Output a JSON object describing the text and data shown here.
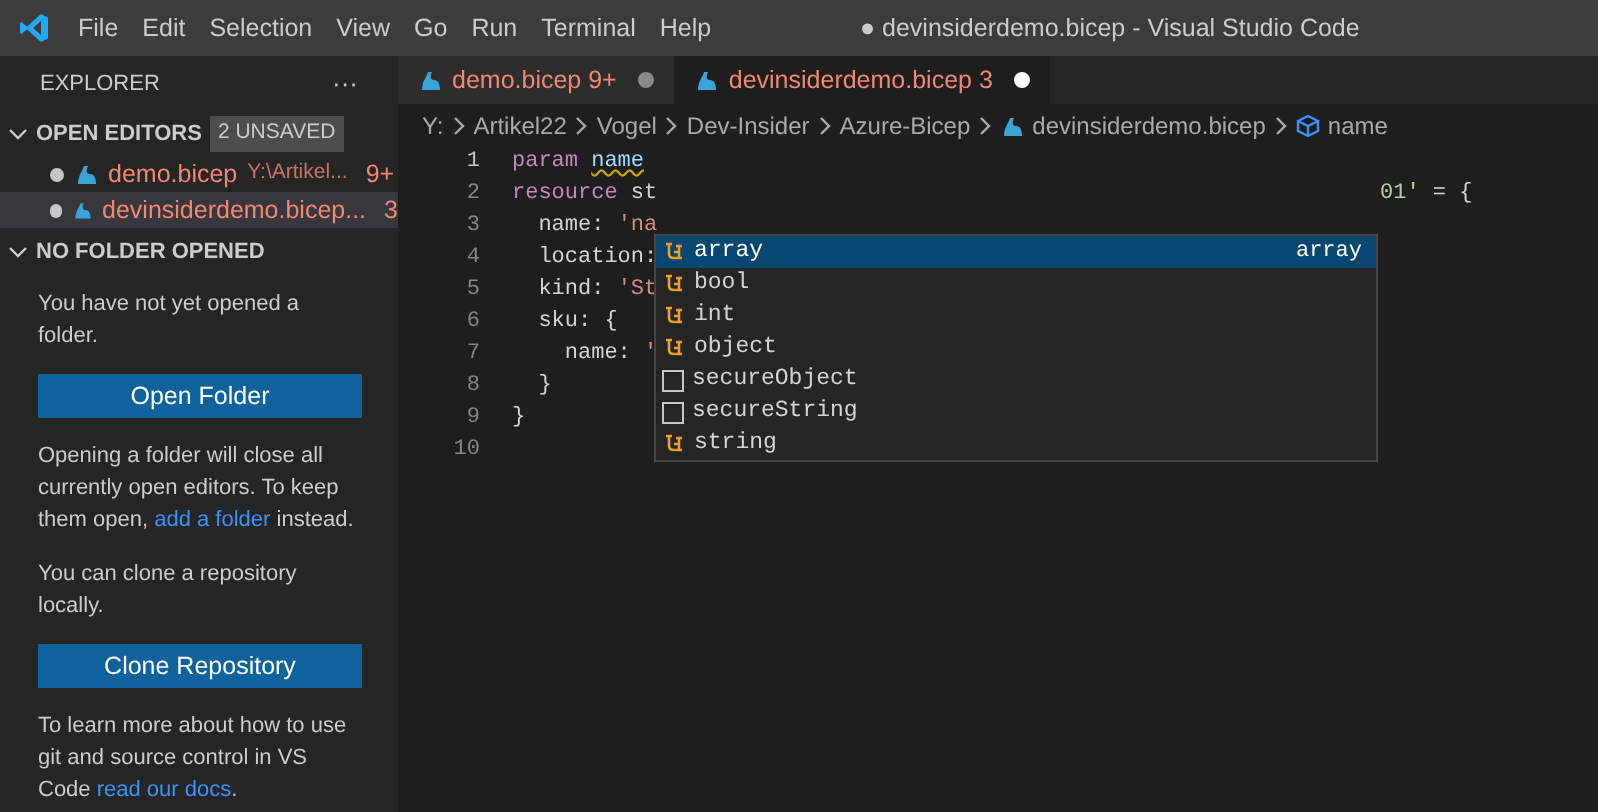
{
  "window": {
    "title": "● devinsiderdemo.bicep - Visual Studio Code"
  },
  "menu": [
    "File",
    "Edit",
    "Selection",
    "View",
    "Go",
    "Run",
    "Terminal",
    "Help"
  ],
  "sidebar": {
    "title": "EXPLORER",
    "more": "···",
    "open_editors": {
      "label": "OPEN EDITORS",
      "badge": "2 UNSAVED",
      "expanded": true,
      "items": [
        {
          "name": "demo.bicep",
          "path": "Y:\\Artikel...",
          "problems": "9+",
          "dirty": true,
          "selected": false
        },
        {
          "name": "devinsiderdemo.bicep...",
          "problems": "3",
          "dirty": true,
          "selected": true
        }
      ]
    },
    "no_folder": {
      "label": "NO FOLDER OPENED",
      "expanded": true,
      "blocks": [
        {
          "kind": "text",
          "text": "You have not yet opened a folder."
        },
        {
          "kind": "button",
          "text": "Open Folder"
        },
        {
          "kind": "text",
          "text": "Opening a folder will close all currently open editors. To keep them open, ",
          "link": "add a folder",
          "after": " instead."
        },
        {
          "kind": "text",
          "text": "You can clone a repository locally."
        },
        {
          "kind": "button",
          "text": "Clone Repository"
        },
        {
          "kind": "text",
          "text": "To learn more about how to use git and source control in VS Code ",
          "link": "read our docs",
          "after": "."
        }
      ]
    }
  },
  "tabs": [
    {
      "name": "demo.bicep",
      "problems": "9+",
      "dirty": true,
      "selected": false
    },
    {
      "name": "devinsiderdemo.bicep",
      "problems": "3",
      "dirty": true,
      "selected": true
    }
  ],
  "breadcrumb": [
    {
      "kind": "text",
      "text": "Y:"
    },
    {
      "kind": "text",
      "text": "Artikel22"
    },
    {
      "kind": "text",
      "text": "Vogel"
    },
    {
      "kind": "text",
      "text": "Dev-Insider"
    },
    {
      "kind": "text",
      "text": "Azure-Bicep"
    },
    {
      "kind": "file",
      "text": "devinsiderdemo.bicep"
    },
    {
      "kind": "symbol",
      "text": "name"
    }
  ],
  "code": [
    {
      "number": "1",
      "current": true,
      "tokens": [
        {
          "kind": "keyword",
          "text": "param "
        },
        {
          "kind": "error",
          "text": "name"
        }
      ]
    },
    {
      "number": "2",
      "current": false,
      "tokens": [
        {
          "kind": "keyword",
          "text": "resource"
        },
        {
          "kind": "plain",
          "text": " st"
        }
      ],
      "tail": [
        {
          "kind": "number",
          "text": "01'"
        },
        {
          "kind": "plain",
          "text": " = {"
        }
      ]
    },
    {
      "number": "3",
      "current": false,
      "tokens": [
        {
          "kind": "plain",
          "text": "  name: "
        },
        {
          "kind": "string",
          "text": "'na"
        }
      ]
    },
    {
      "number": "4",
      "current": false,
      "tokens": [
        {
          "kind": "plain",
          "text": "  location:"
        }
      ]
    },
    {
      "number": "5",
      "current": false,
      "tokens": [
        {
          "kind": "plain",
          "text": "  kind: "
        },
        {
          "kind": "string",
          "text": "'St"
        }
      ]
    },
    {
      "number": "6",
      "current": false,
      "tokens": [
        {
          "kind": "plain",
          "text": "  sku: {"
        }
      ]
    },
    {
      "number": "7",
      "current": false,
      "tokens": [
        {
          "kind": "plain",
          "text": "    name: "
        },
        {
          "kind": "string",
          "text": "'"
        }
      ]
    },
    {
      "number": "8",
      "current": false,
      "tokens": [
        {
          "kind": "plain",
          "text": "  }"
        }
      ]
    },
    {
      "number": "9",
      "current": false,
      "tokens": [
        {
          "kind": "plain",
          "text": "}"
        }
      ]
    },
    {
      "number": "10",
      "current": false
    }
  ],
  "suggestions": [
    {
      "label": "array",
      "kind": "type",
      "detail": "array",
      "selected": true
    },
    {
      "label": "bool",
      "kind": "type",
      "selected": false
    },
    {
      "label": "int",
      "kind": "type",
      "selected": false
    },
    {
      "label": "object",
      "kind": "type",
      "selected": false
    },
    {
      "label": "secureObject",
      "kind": "snippet",
      "selected": false
    },
    {
      "label": "secureString",
      "kind": "snippet",
      "selected": false
    },
    {
      "label": "string",
      "kind": "type",
      "selected": false
    }
  ]
}
